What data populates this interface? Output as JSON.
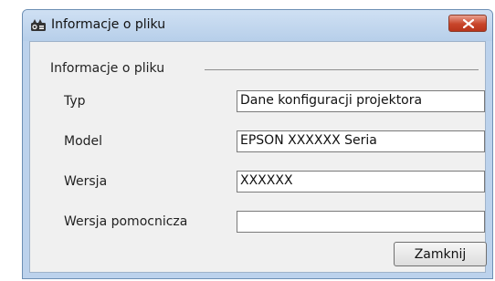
{
  "window": {
    "title": "Informacje o pliku",
    "close_glyph": "✕"
  },
  "group": {
    "title": "Informacje o pliku"
  },
  "fields": [
    {
      "label": "Typ",
      "value": "Dane konfiguracji projektora"
    },
    {
      "label": "Model",
      "value": "EPSON XXXXXX Seria"
    },
    {
      "label": "Wersja",
      "value": "XXXXXX"
    },
    {
      "label": "Wersja pomocnicza",
      "value": ""
    }
  ],
  "buttons": {
    "close_label": "Zamknij"
  },
  "icons": {
    "app": "projector-icon",
    "close": "close-icon"
  },
  "colors": {
    "titlebar": "#bcd2ec",
    "close_button": "#c8452a",
    "client": "#f0f0f0"
  }
}
